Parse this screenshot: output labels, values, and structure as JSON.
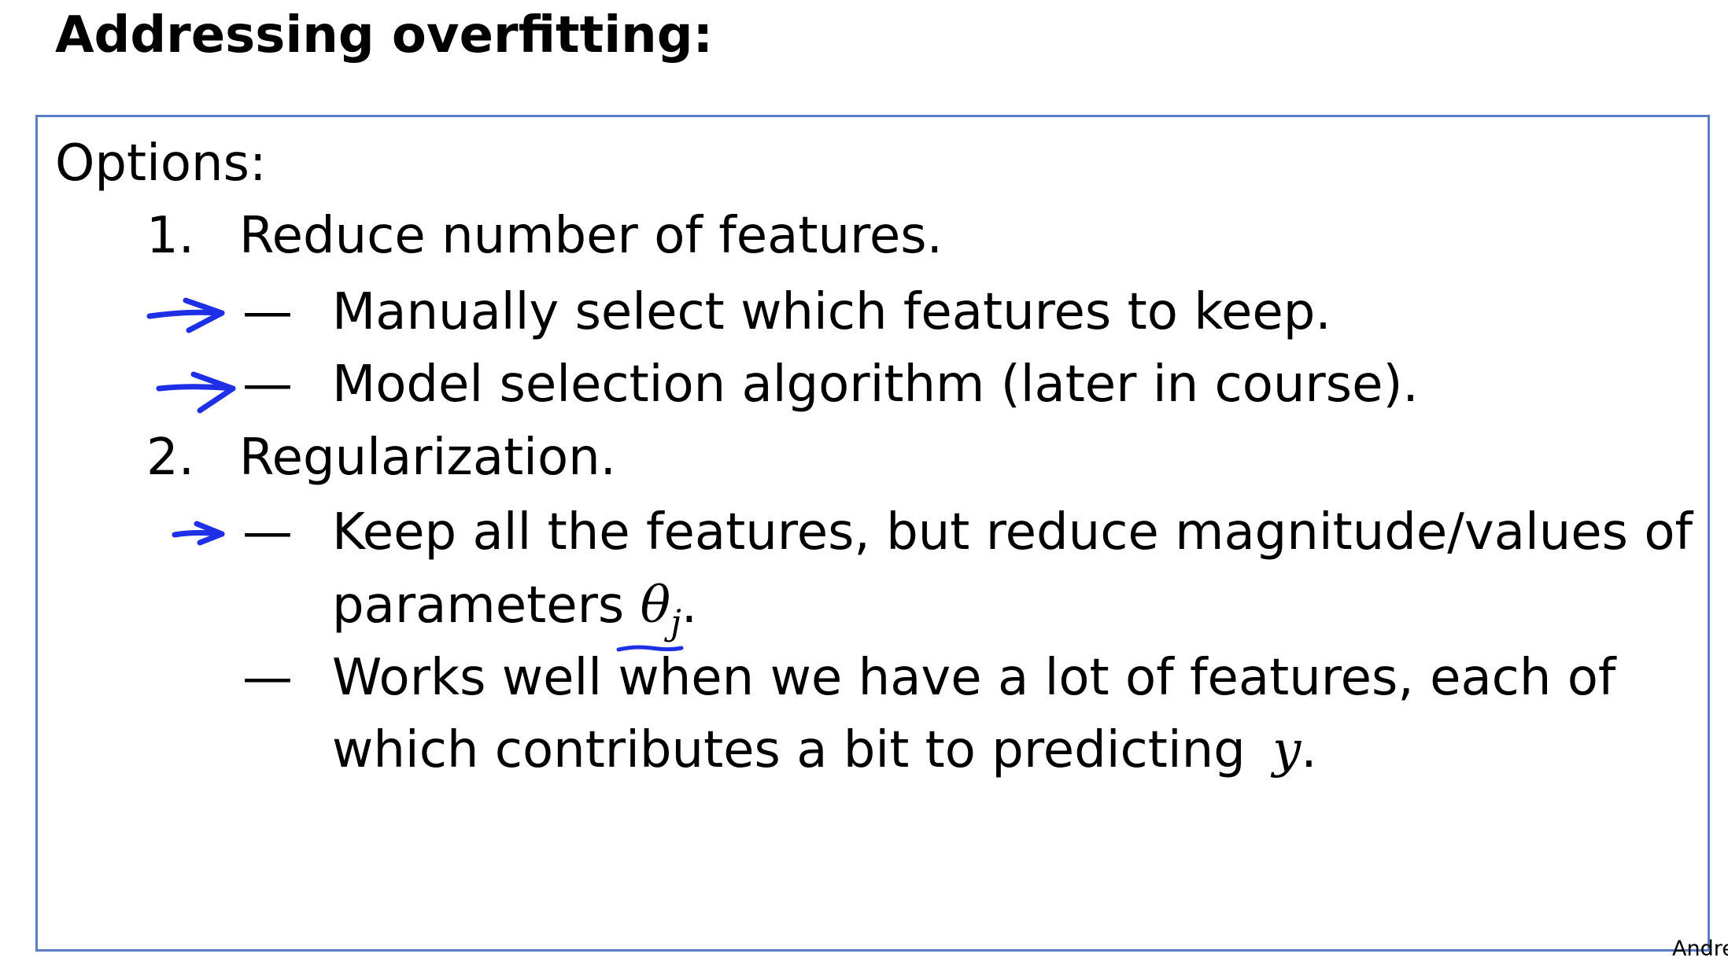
{
  "slide": {
    "title": "Addressing overfitting:",
    "options_heading": "Options:",
    "items": [
      {
        "number": "1.",
        "label": "Reduce number of features."
      },
      {
        "number": "2.",
        "label": "Regularization."
      }
    ],
    "sub_items": {
      "manual": {
        "dash": "—",
        "text": "Manually select which features to keep."
      },
      "model": {
        "dash": "—",
        "text": "Model selection algorithm (later in course)."
      },
      "keep": {
        "dash": "—",
        "line1": "Keep all the features, but reduce magnitude/values of",
        "line2_prefix": "parameters",
        "theta": "θ",
        "theta_sub": "j",
        "line2_suffix": "."
      },
      "works": {
        "dash": "—",
        "line1": "Works well when we have a lot of features, each of",
        "line2_prefix": "which contributes a bit to predicting",
        "y": "y",
        "line2_suffix": "."
      }
    },
    "author_credit": "Andre"
  },
  "annotations": {
    "ink_color": "#1e2fe6",
    "marks": [
      "arrow-icon",
      "arrow-icon",
      "arrow-icon",
      "underline"
    ]
  }
}
